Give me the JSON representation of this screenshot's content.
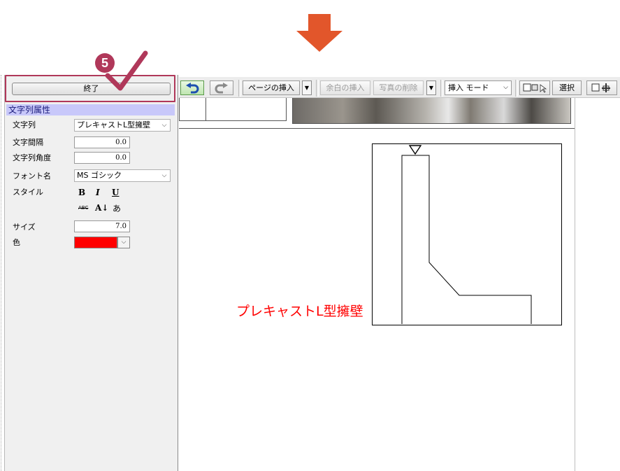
{
  "step": {
    "number": "5"
  },
  "panel": {
    "end_button": "終了",
    "header": "文字列属性",
    "labels": {
      "text": "文字列",
      "spacing": "文字間隔",
      "angle": "文字列角度",
      "font": "フォント名",
      "style": "スタイル",
      "size": "サイズ",
      "color": "色"
    },
    "values": {
      "text": "プレキャストL型擁壁",
      "spacing": "0.0",
      "angle": "0.0",
      "font": "MS ゴシック",
      "size": "7.0",
      "color": "#ff0000"
    },
    "style_buttons": {
      "bold": "B",
      "italic": "I",
      "underline": "U",
      "strike": "ABC",
      "vertical": "A↓",
      "kana": "あ"
    }
  },
  "toolbar": {
    "insert_page": "ページの挿入",
    "insert_margin": "余白の挿入",
    "delete_photo": "写真の削除",
    "insert_mode": "挿入 モード",
    "select": "選択"
  },
  "canvas": {
    "caption": "プレキャストL型擁壁",
    "caption_color": "#ff0000"
  },
  "colors": {
    "accent": "#b0385a",
    "arrow": "#e2562b",
    "header_bg": "#c8c8fa"
  }
}
